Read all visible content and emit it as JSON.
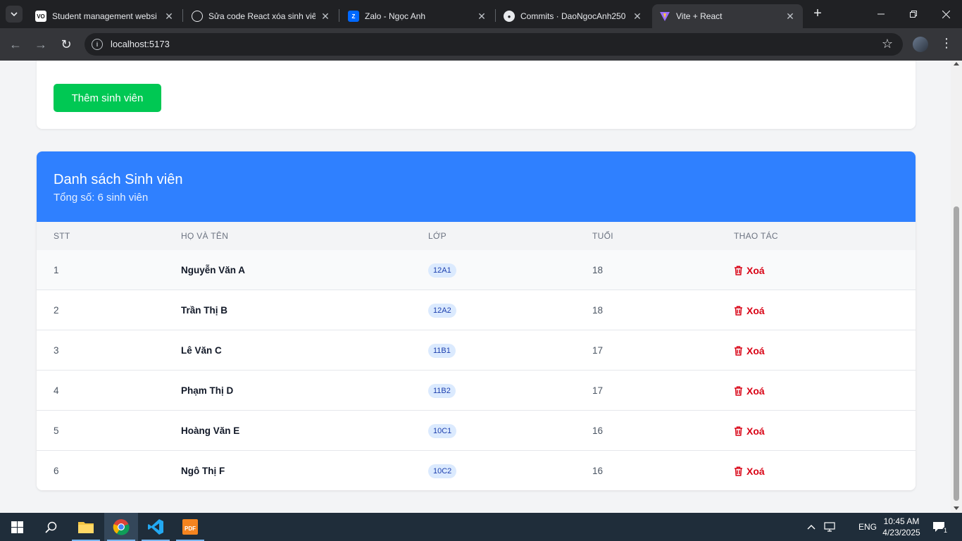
{
  "browser": {
    "tabs": [
      {
        "title": "Student management websi",
        "favicon": "student-site-icon",
        "active": false
      },
      {
        "title": "Sửa code React xóa sinh viên",
        "favicon": "chatgpt-icon",
        "active": false
      },
      {
        "title": "Zalo - Ngọc Anh",
        "favicon": "zalo-icon",
        "active": false
      },
      {
        "title": "Commits · DaoNgocAnh250",
        "favicon": "github-icon",
        "active": false
      },
      {
        "title": "Vite + React",
        "favicon": "vite-icon",
        "active": true
      }
    ],
    "url": "localhost:5173"
  },
  "form": {
    "add_button_label": "Thêm sinh viên"
  },
  "list": {
    "title": "Danh sách Sinh viên",
    "subtitle": "Tổng số: 6 sinh viên",
    "columns": [
      "STT",
      "HỌ VÀ TÊN",
      "LỚP",
      "TUỔI",
      "THAO TÁC"
    ],
    "delete_label": "Xoá",
    "rows": [
      {
        "stt": "1",
        "name": "Nguyễn Văn A",
        "class": "12A1",
        "age": "18"
      },
      {
        "stt": "2",
        "name": "Trần Thị B",
        "class": "12A2",
        "age": "18"
      },
      {
        "stt": "3",
        "name": "Lê Văn C",
        "class": "11B1",
        "age": "17"
      },
      {
        "stt": "4",
        "name": "Phạm Thị D",
        "class": "11B2",
        "age": "17"
      },
      {
        "stt": "5",
        "name": "Hoàng Văn E",
        "class": "10C1",
        "age": "16"
      },
      {
        "stt": "6",
        "name": "Ngô Thị F",
        "class": "10C2",
        "age": "16"
      }
    ]
  },
  "taskbar": {
    "language": "ENG",
    "time": "10:45 AM",
    "date": "4/23/2025",
    "notification_count": "1"
  },
  "colors": {
    "header_blue": "#2f80ff",
    "add_green": "#00c853",
    "delete_red": "#d90416",
    "badge_bg": "#dbeafe"
  }
}
